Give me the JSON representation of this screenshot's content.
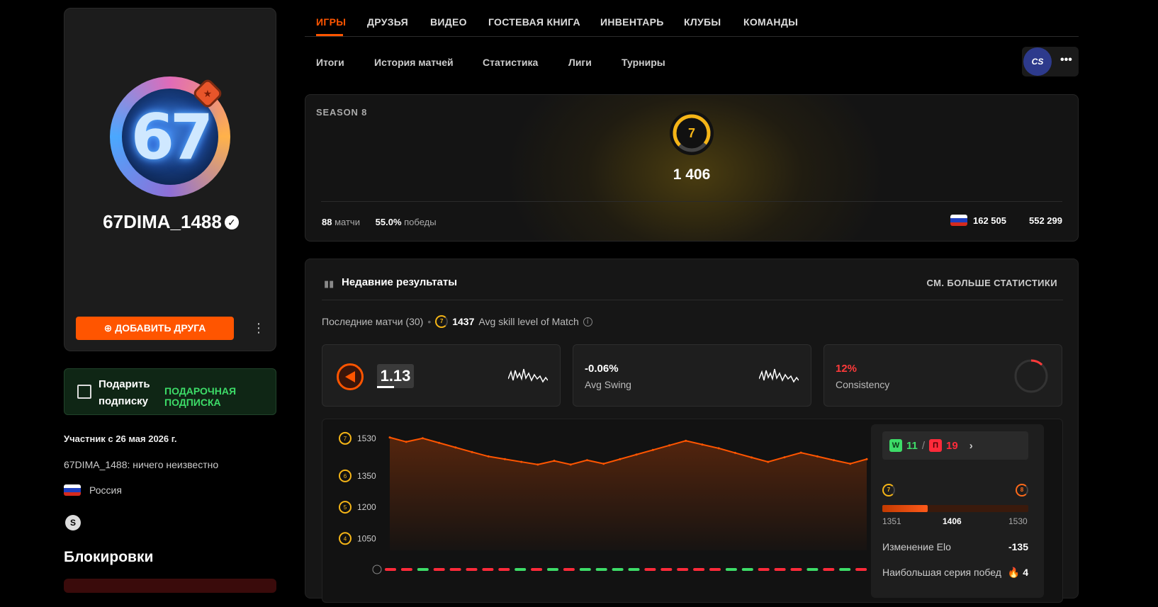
{
  "profile": {
    "avatar_text": "67",
    "username": "67DIMA_1488",
    "add_friend_label": "ДОБАВИТЬ ДРУГА",
    "gift": {
      "title": "Подарить подписку",
      "cta": "ПОДАРОЧНАЯ ПОДПИСКА"
    },
    "member_since": "Участник с 26 мая 2026 г.",
    "bio": "67DIMA_1488: ничего неизвестно",
    "country": "Россия",
    "blocks_title": "Блокировки"
  },
  "nav": {
    "tabs": [
      "ИГРЫ",
      "ДРУЗЬЯ",
      "ВИДЕО",
      "ГОСТЕВАЯ КНИГА",
      "ИНВЕНТАРЬ",
      "КЛУБЫ",
      "КОМАНДЫ"
    ],
    "active_tab": "ИГРЫ",
    "subtabs": [
      "Итоги",
      "История матчей",
      "Статистика",
      "Лиги",
      "Турниры"
    ],
    "game_badge": "CS"
  },
  "season": {
    "label": "SEASON 8",
    "level": "7",
    "elo": "1 406",
    "matches_value": "88",
    "matches_label": "матчи",
    "winrate_value": "55.0%",
    "winrate_label": "победы",
    "country_rank": "162 505",
    "global_rank": "552 299"
  },
  "results": {
    "title": "Недавние результаты",
    "more_link": "СМ. БОЛЬШЕ СТАТИСТИКИ",
    "last_matches": "Последние матчи (30)",
    "avg_skill_value": "1437",
    "avg_skill_label": "Avg skill level of Match",
    "cards": {
      "kd": "1.13",
      "swing_value": "-0.06%",
      "swing_label": "Avg Swing",
      "consistency_value": "12%",
      "consistency_label": "Consistency",
      "consistency_fraction": 0.12
    },
    "summary": {
      "wins": "11",
      "losses": "19",
      "level_from": "7",
      "level_to": "8",
      "range_low": "1351",
      "current": "1406",
      "range_high": "1530",
      "progress_fraction": 0.31,
      "elo_change_label": "Изменение Elo",
      "elo_change_value": "-135",
      "streak_label": "Наибольшая серия побед",
      "streak_value": "4"
    }
  },
  "colors": {
    "accent": "#ff5500",
    "win": "#3ddc68",
    "loss": "#ff2a3a",
    "level": "#f5b517"
  },
  "chart_data": {
    "type": "area",
    "title": "",
    "xlabel": "",
    "ylabel": "",
    "ylim": [
      1000,
      1560
    ],
    "y_ticks": [
      {
        "value": 1530,
        "label": "1530",
        "level": "7"
      },
      {
        "value": 1350,
        "label": "1350",
        "level": "6"
      },
      {
        "value": 1200,
        "label": "1200",
        "level": "5"
      },
      {
        "value": 1050,
        "label": "1050",
        "level": "4"
      }
    ],
    "series": [
      {
        "values": [
          1541,
          1520,
          1537,
          1515,
          1493,
          1471,
          1450,
          1437,
          1424,
          1411,
          1429,
          1411,
          1432,
          1415,
          1437,
          1459,
          1481,
          1503,
          1525,
          1507,
          1489,
          1467,
          1445,
          1424,
          1446,
          1468,
          1450,
          1432,
          1415,
          1437
        ]
      }
    ],
    "results": [
      "L",
      "L",
      "W",
      "L",
      "L",
      "L",
      "L",
      "L",
      "W",
      "L",
      "W",
      "L",
      "W",
      "W",
      "W",
      "W",
      "L",
      "L",
      "L",
      "L",
      "L",
      "W",
      "W",
      "L",
      "L",
      "L",
      "W",
      "L",
      "W",
      "L"
    ]
  }
}
